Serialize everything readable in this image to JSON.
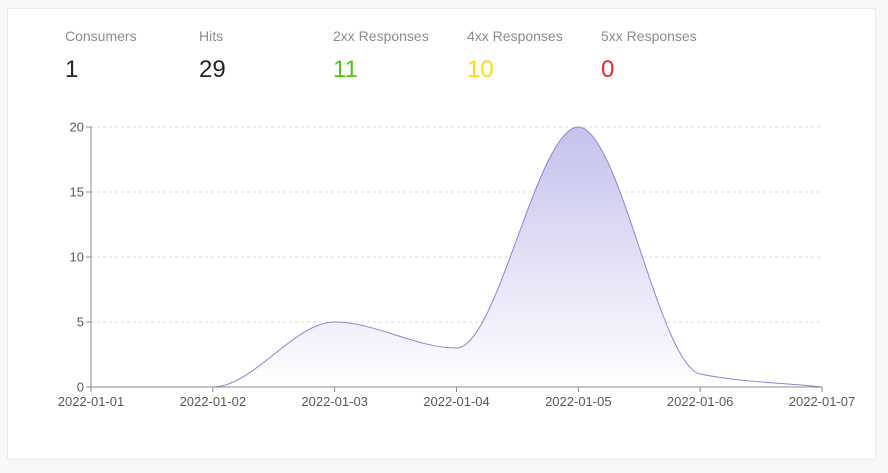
{
  "stats": [
    {
      "label": "Consumers",
      "value": "1",
      "color": "#262626"
    },
    {
      "label": "Hits",
      "value": "29",
      "color": "#262626"
    },
    {
      "label": "2xx Responses",
      "value": "11",
      "color": "#52c41a"
    },
    {
      "label": "4xx Responses",
      "value": "10",
      "color": "#fadb14"
    },
    {
      "label": "5xx Responses",
      "value": "0",
      "color": "#f5222d"
    }
  ],
  "chart_data": {
    "type": "area",
    "x": [
      "2022-01-01",
      "2022-01-02",
      "2022-01-03",
      "2022-01-04",
      "2022-01-05",
      "2022-01-06",
      "2022-01-07"
    ],
    "series": [
      {
        "values": [
          0,
          0,
          5,
          3,
          20,
          1,
          0
        ]
      }
    ],
    "ylim": [
      0,
      20
    ],
    "yticks": [
      0,
      5,
      10,
      15,
      20
    ],
    "xticks": [
      "2022-01-01",
      "2022-01-02",
      "2022-01-03",
      "2022-01-04",
      "2022-01-05",
      "2022-01-06",
      "2022-01-07"
    ],
    "grid": true,
    "line_color": "#8c86d4",
    "fill_color": "#c5c1ec"
  }
}
